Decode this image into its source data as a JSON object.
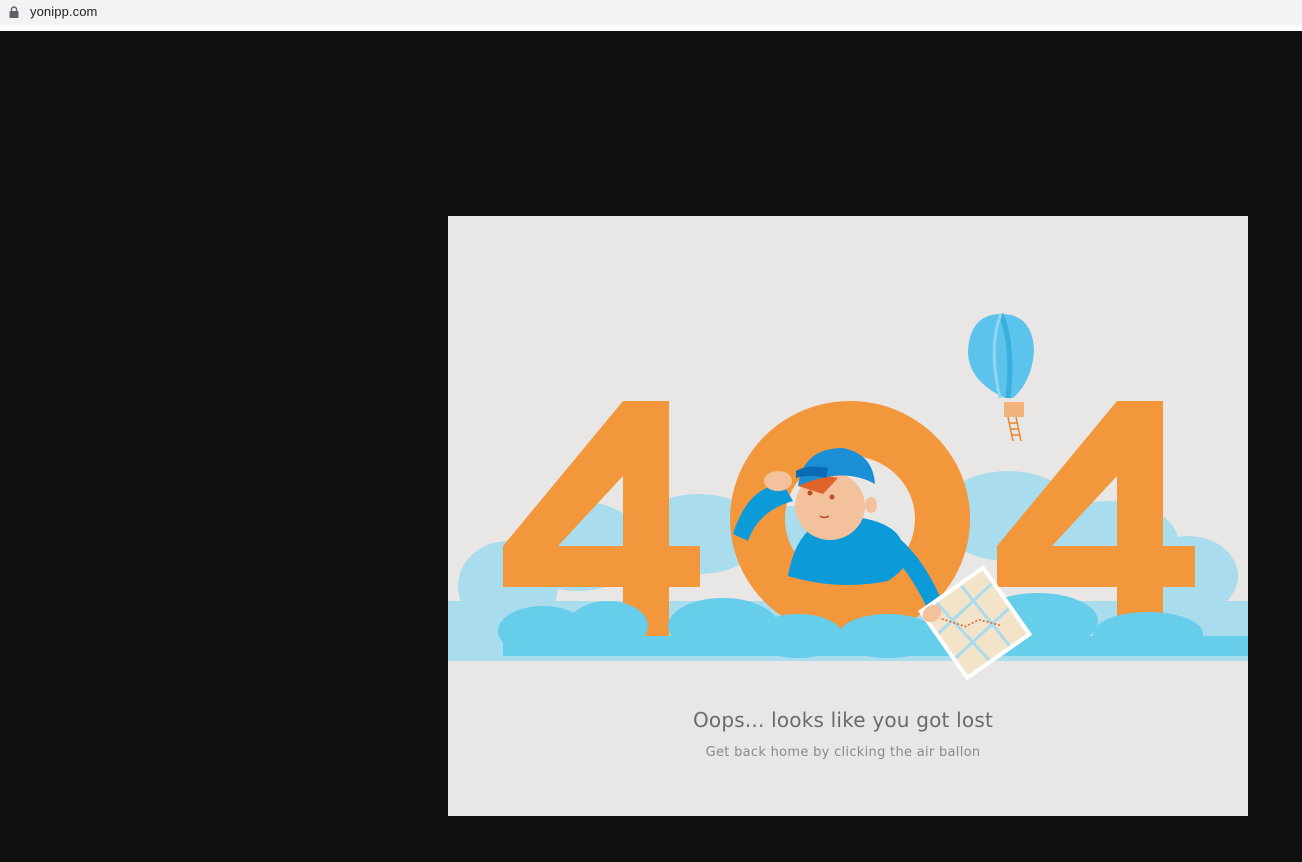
{
  "browser": {
    "url": "yonipp.com",
    "icons": {
      "secure": "lock-icon"
    }
  },
  "error_page": {
    "code_left_digit": "4",
    "code_right_digit": "4",
    "headline": "Oops... looks like you got lost",
    "subline": "Get back home by clicking the air ballon"
  },
  "colors": {
    "page_background": "#0f0f0f",
    "card_background": "#e9e7e5",
    "digit_orange": "#f2973c",
    "cloud_light": "#a9dcec",
    "cloud_dark": "#66cdea",
    "character_blue": "#0d9ad9",
    "balloon_blue": "#5bc3ec"
  }
}
